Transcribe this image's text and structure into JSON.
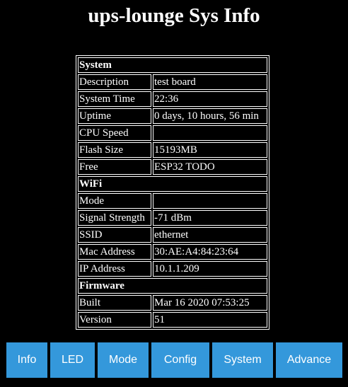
{
  "title": "ups-lounge Sys Info",
  "sections": [
    {
      "heading": "System",
      "rows": [
        {
          "label": "Description",
          "value": "test board"
        },
        {
          "label": "System Time",
          "value": "22:36"
        },
        {
          "label": "Uptime",
          "value": "0 days, 10 hours, 56 min"
        },
        {
          "label": "CPU Speed",
          "value": ""
        },
        {
          "label": "Flash Size",
          "value": "15193MB"
        },
        {
          "label": "Free",
          "value": "ESP32 TODO"
        }
      ]
    },
    {
      "heading": "WiFi",
      "rows": [
        {
          "label": "Mode",
          "value": ""
        },
        {
          "label": "Signal Strength",
          "value": "-71 dBm"
        },
        {
          "label": "SSID",
          "value": "ethernet"
        },
        {
          "label": "Mac Address",
          "value": "30:AE:A4:84:23:64"
        },
        {
          "label": "IP Address",
          "value": "10.1.1.209"
        }
      ]
    },
    {
      "heading": "Firmware",
      "rows": [
        {
          "label": "Built",
          "value": "Mar 16 2020 07:53:25"
        },
        {
          "label": "Version",
          "value": "51"
        }
      ]
    }
  ],
  "nav": [
    {
      "label": "Info"
    },
    {
      "label": "LED"
    },
    {
      "label": "Mode"
    },
    {
      "label": "Config"
    },
    {
      "label": "System"
    },
    {
      "label": "Advance"
    }
  ],
  "colors": {
    "background": "#000000",
    "text": "#ffffff",
    "button": "#3498db"
  }
}
